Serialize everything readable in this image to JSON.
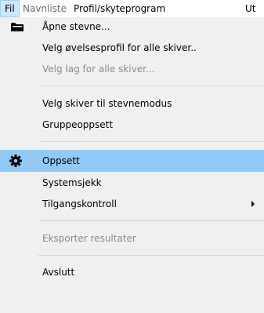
{
  "menubar": {
    "items": [
      {
        "label": "Fil",
        "state": "active"
      },
      {
        "label": "Navnliste",
        "state": "disabled"
      },
      {
        "label": "Profil/skyteprogram",
        "state": "normal"
      },
      {
        "label": "Ut",
        "state": "normal"
      }
    ]
  },
  "menu": {
    "items": [
      {
        "label": "Åpne stevne...",
        "icon": "folder-icon",
        "disabled": false
      },
      {
        "label": "Velg øvelsesprofil for alle skiver..",
        "disabled": false
      },
      {
        "label": "Velg lag for alle skiver...",
        "disabled": true
      },
      {
        "label": "Velg skiver til stevnemodus",
        "disabled": false
      },
      {
        "label": "Gruppeoppsett",
        "disabled": false
      },
      {
        "label": "Oppsett",
        "icon": "gear-icon",
        "disabled": false,
        "highlighted": true
      },
      {
        "label": "Systemsjekk",
        "disabled": false
      },
      {
        "label": "Tilgangskontroll",
        "disabled": false,
        "submenu": true
      },
      {
        "label": "Eksporter resultater",
        "disabled": true
      },
      {
        "label": "Avslutt",
        "disabled": false
      }
    ]
  },
  "colors": {
    "highlight": "#91c9f7",
    "menubar_active": "#cce8ff",
    "disabled_text": "#8c8c8c"
  }
}
